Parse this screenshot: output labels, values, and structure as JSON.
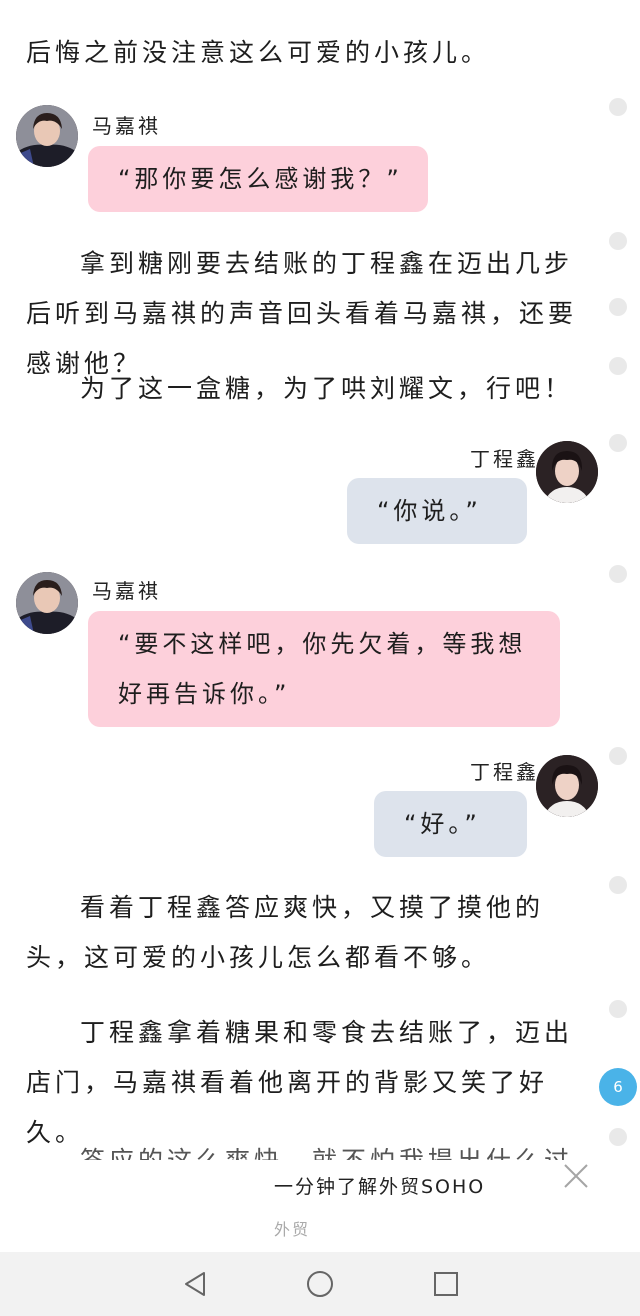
{
  "paragraphs": {
    "p0": "后悔之前没注意这么可爱的小孩儿。",
    "p1": "拿到糖刚要去结账的丁程鑫在迈出几步后听到马嘉祺的声音回头看着马嘉祺，还要感谢他？",
    "p2": "为了这一盒糖，为了哄刘耀文，行吧！",
    "p3": "看着丁程鑫答应爽快，又摸了摸他的头，这可爱的小孩儿怎么都看不够。",
    "p4": "丁程鑫拿着糖果和零食去结账了，迈出店门，马嘉祺看着他离开的背影又笑了好久。",
    "p5_partial": "答应的这么爽快，就不怕我提出什么过分的"
  },
  "chat": {
    "m1": {
      "name": "马嘉祺",
      "text": "“那你要怎么感谢我？”"
    },
    "m2": {
      "name": "丁程鑫",
      "text": "“你说。”"
    },
    "m3": {
      "name": "马嘉祺",
      "line1": "“要不这样吧，你先欠着，等我想",
      "line2": "好再告诉你。”"
    },
    "m4": {
      "name": "丁程鑫",
      "text": "“好。”"
    }
  },
  "page_badge": "6",
  "ad": {
    "title": "一分钟了解外贸SOHO",
    "tag": "外贸"
  },
  "colors": {
    "pink_bubble": "#fdd0db",
    "blue_bubble": "#dde3ec",
    "badge": "#4ab3e8"
  },
  "icons": {
    "close": "close-icon",
    "back": "back-triangle-icon",
    "home": "home-circle-icon",
    "recents": "recents-square-icon"
  }
}
